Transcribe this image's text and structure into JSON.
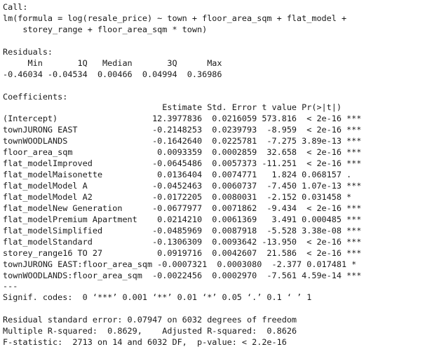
{
  "output": {
    "call_header": "Call:",
    "call_line1": "lm(formula = log(resale_price) ~ town + floor_area_sqm + flat_model +",
    "call_line2": "    storey_range + floor_area_sqm * town)",
    "residuals_header": "Residuals:",
    "residuals_labels": "     Min       1Q   Median       3Q      Max ",
    "residuals_values": "-0.46034 -0.04534  0.00466  0.04994  0.36986 ",
    "coefficients_header": "Coefficients:",
    "coef_col_header": "                                Estimate Std. Error t value Pr(>|t|)    ",
    "coef_rows": [
      "(Intercept)                   12.3977836  0.0216059 573.816  < 2e-16 ***",
      "townJURONG EAST               -0.2148253  0.0239793  -8.959  < 2e-16 ***",
      "townWOODLANDS                 -0.1642640  0.0225781  -7.275 3.89e-13 ***",
      "floor_area_sqm                 0.0093359  0.0002859  32.658  < 2e-16 ***",
      "flat_modelImproved            -0.0645486  0.0057373 -11.251  < 2e-16 ***",
      "flat_modelMaisonette           0.0136404  0.0074771   1.824 0.068157 .  ",
      "flat_modelModel A             -0.0452463  0.0060737  -7.450 1.07e-13 ***",
      "flat_modelModel A2            -0.0172205  0.0080031  -2.152 0.031458 *  ",
      "flat_modelNew Generation      -0.0677977  0.0071862  -9.434  < 2e-16 ***",
      "flat_modelPremium Apartment    0.0214210  0.0061369   3.491 0.000485 ***",
      "flat_modelSimplified          -0.0485969  0.0087918  -5.528 3.38e-08 ***",
      "flat_modelStandard            -0.1306309  0.0093642 -13.950  < 2e-16 ***",
      "storey_range16 TO 27           0.0919716  0.0042607  21.586  < 2e-16 ***",
      "townJURONG EAST:floor_area_sqm -0.0007321  0.0003080  -2.377 0.017481 *  ",
      "townWOODLANDS:floor_area_sqm  -0.0022456  0.0002970  -7.561 4.59e-14 ***"
    ],
    "separator": "---",
    "signif_codes": "Signif. codes:  0 ‘***’ 0.001 ‘**’ 0.01 ‘*’ 0.05 ‘.’ 0.1 ‘ ’ 1",
    "residual_se": "Residual standard error: 0.07947 on 6032 degrees of freedom",
    "r_squared": "Multiple R-squared:  0.8629,\tAdjusted R-squared:  0.8626 ",
    "f_statistic": "F-statistic:  2713 on 14 and 6032 DF,  p-value: < 2.2e-16"
  }
}
